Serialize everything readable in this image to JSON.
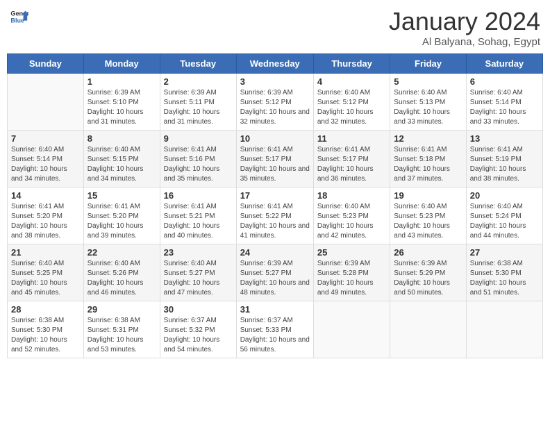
{
  "header": {
    "logo_general": "General",
    "logo_blue": "Blue",
    "month_title": "January 2024",
    "location": "Al Balyana, Sohag, Egypt"
  },
  "columns": [
    "Sunday",
    "Monday",
    "Tuesday",
    "Wednesday",
    "Thursday",
    "Friday",
    "Saturday"
  ],
  "weeks": [
    [
      {
        "day": "",
        "sunrise": "",
        "sunset": "",
        "daylight": ""
      },
      {
        "day": "1",
        "sunrise": "Sunrise: 6:39 AM",
        "sunset": "Sunset: 5:10 PM",
        "daylight": "Daylight: 10 hours and 31 minutes."
      },
      {
        "day": "2",
        "sunrise": "Sunrise: 6:39 AM",
        "sunset": "Sunset: 5:11 PM",
        "daylight": "Daylight: 10 hours and 31 minutes."
      },
      {
        "day": "3",
        "sunrise": "Sunrise: 6:39 AM",
        "sunset": "Sunset: 5:12 PM",
        "daylight": "Daylight: 10 hours and 32 minutes."
      },
      {
        "day": "4",
        "sunrise": "Sunrise: 6:40 AM",
        "sunset": "Sunset: 5:12 PM",
        "daylight": "Daylight: 10 hours and 32 minutes."
      },
      {
        "day": "5",
        "sunrise": "Sunrise: 6:40 AM",
        "sunset": "Sunset: 5:13 PM",
        "daylight": "Daylight: 10 hours and 33 minutes."
      },
      {
        "day": "6",
        "sunrise": "Sunrise: 6:40 AM",
        "sunset": "Sunset: 5:14 PM",
        "daylight": "Daylight: 10 hours and 33 minutes."
      }
    ],
    [
      {
        "day": "7",
        "sunrise": "Sunrise: 6:40 AM",
        "sunset": "Sunset: 5:14 PM",
        "daylight": "Daylight: 10 hours and 34 minutes."
      },
      {
        "day": "8",
        "sunrise": "Sunrise: 6:40 AM",
        "sunset": "Sunset: 5:15 PM",
        "daylight": "Daylight: 10 hours and 34 minutes."
      },
      {
        "day": "9",
        "sunrise": "Sunrise: 6:41 AM",
        "sunset": "Sunset: 5:16 PM",
        "daylight": "Daylight: 10 hours and 35 minutes."
      },
      {
        "day": "10",
        "sunrise": "Sunrise: 6:41 AM",
        "sunset": "Sunset: 5:17 PM",
        "daylight": "Daylight: 10 hours and 35 minutes."
      },
      {
        "day": "11",
        "sunrise": "Sunrise: 6:41 AM",
        "sunset": "Sunset: 5:17 PM",
        "daylight": "Daylight: 10 hours and 36 minutes."
      },
      {
        "day": "12",
        "sunrise": "Sunrise: 6:41 AM",
        "sunset": "Sunset: 5:18 PM",
        "daylight": "Daylight: 10 hours and 37 minutes."
      },
      {
        "day": "13",
        "sunrise": "Sunrise: 6:41 AM",
        "sunset": "Sunset: 5:19 PM",
        "daylight": "Daylight: 10 hours and 38 minutes."
      }
    ],
    [
      {
        "day": "14",
        "sunrise": "Sunrise: 6:41 AM",
        "sunset": "Sunset: 5:20 PM",
        "daylight": "Daylight: 10 hours and 38 minutes."
      },
      {
        "day": "15",
        "sunrise": "Sunrise: 6:41 AM",
        "sunset": "Sunset: 5:20 PM",
        "daylight": "Daylight: 10 hours and 39 minutes."
      },
      {
        "day": "16",
        "sunrise": "Sunrise: 6:41 AM",
        "sunset": "Sunset: 5:21 PM",
        "daylight": "Daylight: 10 hours and 40 minutes."
      },
      {
        "day": "17",
        "sunrise": "Sunrise: 6:41 AM",
        "sunset": "Sunset: 5:22 PM",
        "daylight": "Daylight: 10 hours and 41 minutes."
      },
      {
        "day": "18",
        "sunrise": "Sunrise: 6:40 AM",
        "sunset": "Sunset: 5:23 PM",
        "daylight": "Daylight: 10 hours and 42 minutes."
      },
      {
        "day": "19",
        "sunrise": "Sunrise: 6:40 AM",
        "sunset": "Sunset: 5:23 PM",
        "daylight": "Daylight: 10 hours and 43 minutes."
      },
      {
        "day": "20",
        "sunrise": "Sunrise: 6:40 AM",
        "sunset": "Sunset: 5:24 PM",
        "daylight": "Daylight: 10 hours and 44 minutes."
      }
    ],
    [
      {
        "day": "21",
        "sunrise": "Sunrise: 6:40 AM",
        "sunset": "Sunset: 5:25 PM",
        "daylight": "Daylight: 10 hours and 45 minutes."
      },
      {
        "day": "22",
        "sunrise": "Sunrise: 6:40 AM",
        "sunset": "Sunset: 5:26 PM",
        "daylight": "Daylight: 10 hours and 46 minutes."
      },
      {
        "day": "23",
        "sunrise": "Sunrise: 6:40 AM",
        "sunset": "Sunset: 5:27 PM",
        "daylight": "Daylight: 10 hours and 47 minutes."
      },
      {
        "day": "24",
        "sunrise": "Sunrise: 6:39 AM",
        "sunset": "Sunset: 5:27 PM",
        "daylight": "Daylight: 10 hours and 48 minutes."
      },
      {
        "day": "25",
        "sunrise": "Sunrise: 6:39 AM",
        "sunset": "Sunset: 5:28 PM",
        "daylight": "Daylight: 10 hours and 49 minutes."
      },
      {
        "day": "26",
        "sunrise": "Sunrise: 6:39 AM",
        "sunset": "Sunset: 5:29 PM",
        "daylight": "Daylight: 10 hours and 50 minutes."
      },
      {
        "day": "27",
        "sunrise": "Sunrise: 6:38 AM",
        "sunset": "Sunset: 5:30 PM",
        "daylight": "Daylight: 10 hours and 51 minutes."
      }
    ],
    [
      {
        "day": "28",
        "sunrise": "Sunrise: 6:38 AM",
        "sunset": "Sunset: 5:30 PM",
        "daylight": "Daylight: 10 hours and 52 minutes."
      },
      {
        "day": "29",
        "sunrise": "Sunrise: 6:38 AM",
        "sunset": "Sunset: 5:31 PM",
        "daylight": "Daylight: 10 hours and 53 minutes."
      },
      {
        "day": "30",
        "sunrise": "Sunrise: 6:37 AM",
        "sunset": "Sunset: 5:32 PM",
        "daylight": "Daylight: 10 hours and 54 minutes."
      },
      {
        "day": "31",
        "sunrise": "Sunrise: 6:37 AM",
        "sunset": "Sunset: 5:33 PM",
        "daylight": "Daylight: 10 hours and 56 minutes."
      },
      {
        "day": "",
        "sunrise": "",
        "sunset": "",
        "daylight": ""
      },
      {
        "day": "",
        "sunrise": "",
        "sunset": "",
        "daylight": ""
      },
      {
        "day": "",
        "sunrise": "",
        "sunset": "",
        "daylight": ""
      }
    ]
  ]
}
